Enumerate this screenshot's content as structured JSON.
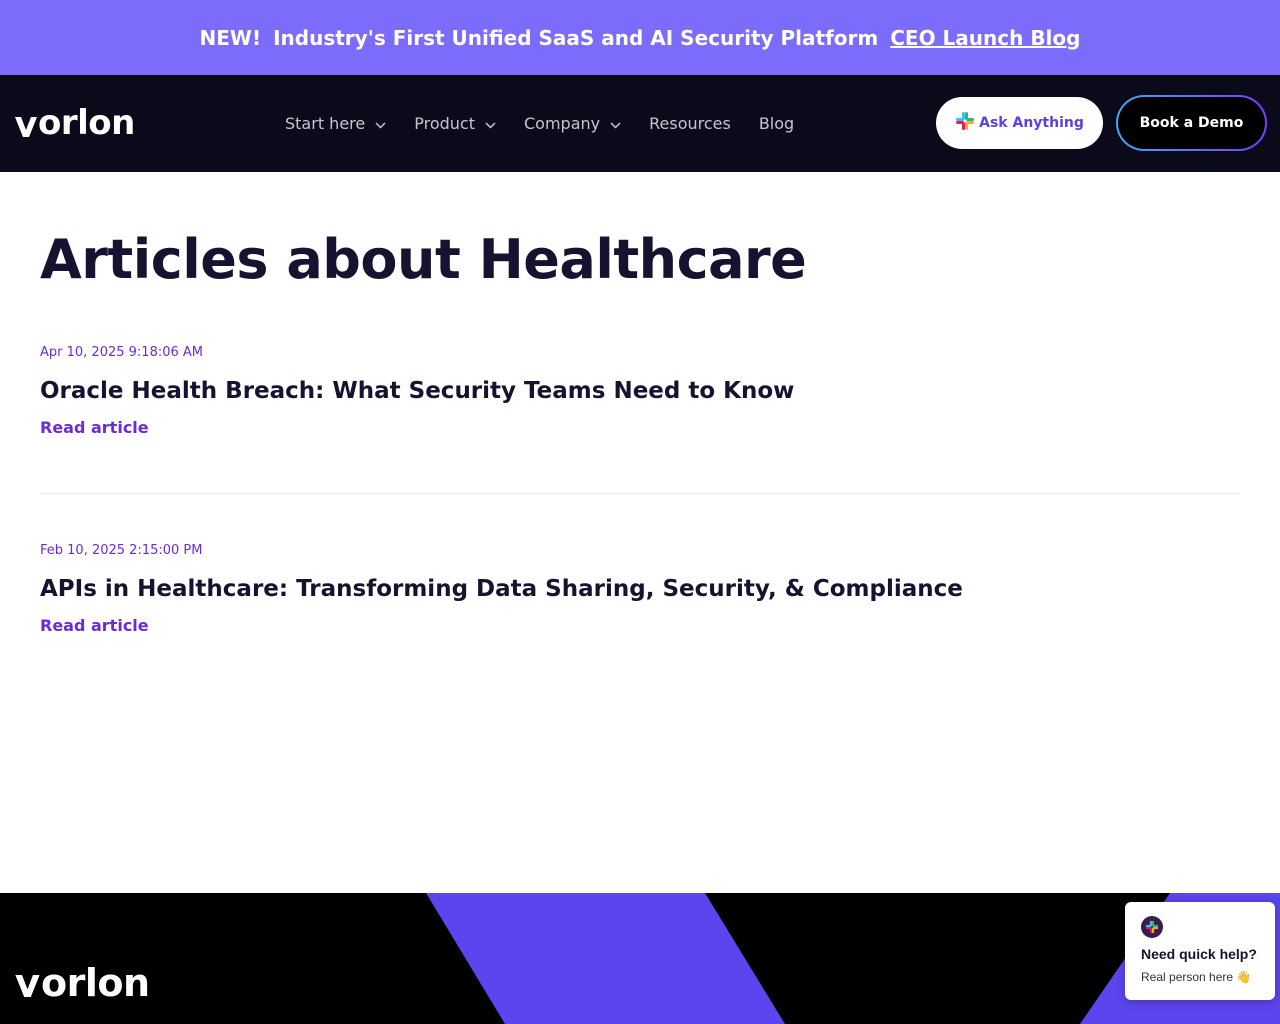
{
  "announcement": {
    "new_label": "NEW!",
    "headline": "Industry's First Unified SaaS and AI Security Platform",
    "link_text": "CEO Launch Blog"
  },
  "nav": {
    "logo_text": "orlon",
    "items": [
      {
        "label": "Start here",
        "has_dropdown": true
      },
      {
        "label": "Product",
        "has_dropdown": true
      },
      {
        "label": "Company",
        "has_dropdown": true
      },
      {
        "label": "Resources",
        "has_dropdown": false
      },
      {
        "label": "Blog",
        "has_dropdown": false
      }
    ],
    "ask_label": "Ask Anything",
    "demo_label": "Book a Demo"
  },
  "main": {
    "page_title": "Articles about Healthcare",
    "articles": [
      {
        "date": "Apr 10, 2025 9:18:06 AM",
        "title": "Oracle Health Breach: What Security Teams Need to Know",
        "link": "Read article"
      },
      {
        "date": "Feb 10, 2025 2:15:00 PM",
        "title": "APIs in Healthcare: Transforming Data Sharing, Security, & Compliance",
        "link": "Read article"
      }
    ]
  },
  "footer": {
    "logo_text": "orlon"
  },
  "chat": {
    "heading": "Need quick help?",
    "subtext": "Real person here 👋"
  },
  "colors": {
    "announcement_bg": "#7b6cfb",
    "nav_bg": "#0a0a1a",
    "accent": "#6c2bd9",
    "footer_stripe": "#5b45ee"
  }
}
